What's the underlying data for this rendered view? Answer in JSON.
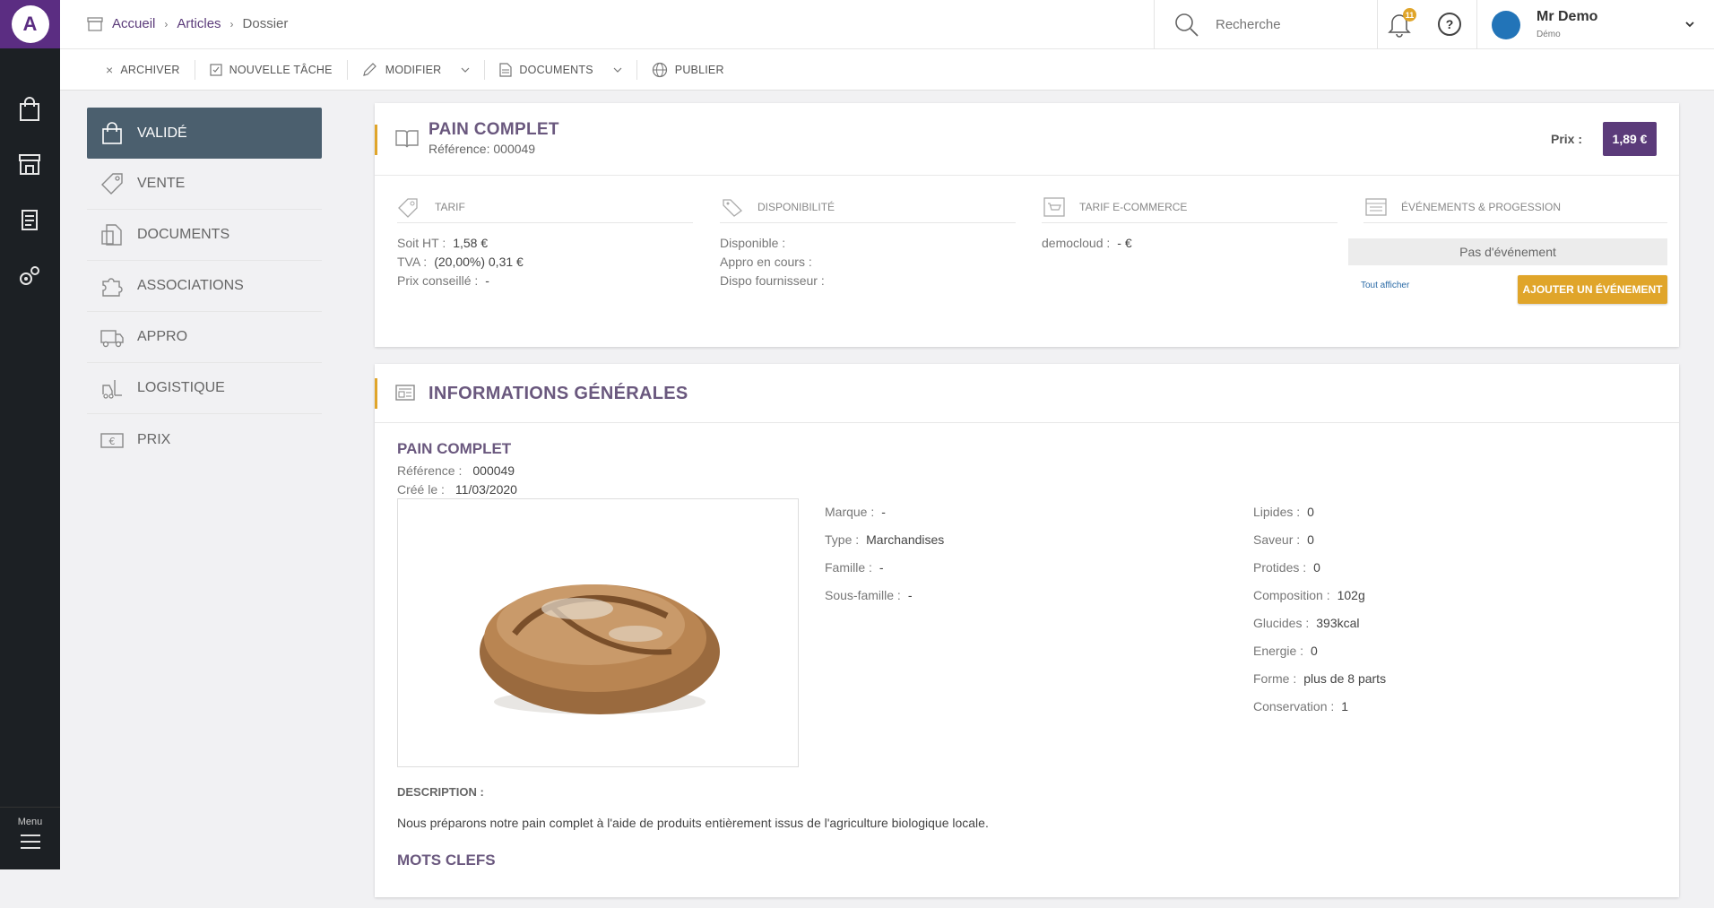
{
  "app": {
    "logo_letter": "A",
    "menu_label": "Menu"
  },
  "rail": {
    "icons": [
      "shopping-bag-icon",
      "store-icon",
      "document-list-icon",
      "settings-gears-icon"
    ]
  },
  "breadcrumb": {
    "home": "Accueil",
    "articles": "Articles",
    "current": "Dossier"
  },
  "search": {
    "placeholder": "Recherche"
  },
  "notifications": {
    "count": "11"
  },
  "help_symbol": "?",
  "user": {
    "name": "Mr Demo",
    "role": "Démo"
  },
  "toolbar": {
    "archive": "ARCHIVER",
    "new_task": "NOUVELLE TÂCHE",
    "edit": "MODIFIER",
    "documents": "DOCUMENTS",
    "publish": "PUBLIER"
  },
  "tabs": [
    {
      "label": "VALIDÉ",
      "icon": "shopping-bag-icon"
    },
    {
      "label": "VENTE",
      "icon": "price-tag-icon"
    },
    {
      "label": "DOCUMENTS",
      "icon": "documents-icon"
    },
    {
      "label": "ASSOCIATIONS",
      "icon": "puzzle-icon"
    },
    {
      "label": "APPRO",
      "icon": "truck-icon"
    },
    {
      "label": "LOGISTIQUE",
      "icon": "forklift-icon"
    },
    {
      "label": "PRIX",
      "icon": "banknote-icon"
    }
  ],
  "product": {
    "title": "PAIN COMPLET",
    "reference_line": "Référence: 000049",
    "price_label": "Prix :",
    "price": "1,89 €"
  },
  "tarif": {
    "header": "TARIF",
    "ht_label": "Soit HT :",
    "ht_value": "1,58 €",
    "tva_label": "TVA :",
    "tva_value": "(20,00%) 0,31 €",
    "conseille_label": "Prix conseillé :",
    "conseille_value": "-"
  },
  "dispo": {
    "header": "DISPONIBILITÉ",
    "disponible": "Disponible :",
    "appro": "Appro en cours :",
    "fournisseur": "Dispo fournisseur :"
  },
  "ecommerce": {
    "header": "TARIF E-COMMERCE",
    "label": "democloud :",
    "value": "- €"
  },
  "events": {
    "header": "ÉVÉNEMENTS & PROGESSION",
    "empty": "Pas d'événement",
    "show_all": "Tout afficher",
    "add_button": "AJOUTER UN ÉVÉNEMENT"
  },
  "general": {
    "header": "INFORMATIONS GÉNÉRALES",
    "name": "PAIN COMPLET",
    "ref_label": "Référence :",
    "ref_value": "000049",
    "created_label": "Créé le :",
    "created_value": "11/03/2020",
    "marque_label": "Marque :",
    "marque_value": "-",
    "type_label": "Type :",
    "type_value": "Marchandises",
    "famille_label": "Famille :",
    "famille_value": "-",
    "sousfamille_label": "Sous-famille :",
    "sousfamille_value": "-",
    "nutrition": [
      {
        "label": "Lipides :",
        "value": "0"
      },
      {
        "label": "Saveur :",
        "value": "0"
      },
      {
        "label": "Protides :",
        "value": "0"
      },
      {
        "label": "Composition :",
        "value": "102g"
      },
      {
        "label": "Glucides :",
        "value": "393kcal"
      },
      {
        "label": "Energie :",
        "value": "0"
      },
      {
        "label": "Forme :",
        "value": "plus de 8 parts"
      },
      {
        "label": "Conservation :",
        "value": "1"
      }
    ],
    "description_header": "DESCRIPTION :",
    "description": "Nous préparons notre pain complet à l'aide de produits entièrement issus de l'agriculture biologique locale.",
    "keywords_header": "MOTS CLEFS"
  },
  "colors": {
    "brand": "#5b2d82",
    "accent": "#e0a52a",
    "active_tab": "#4b5f6e",
    "title": "#6a587e"
  }
}
